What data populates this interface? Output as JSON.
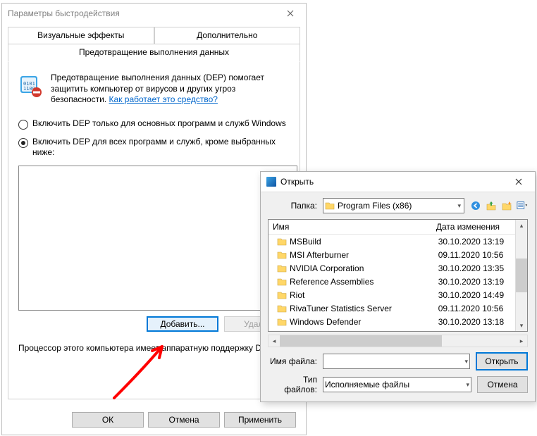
{
  "perf": {
    "title": "Параметры быстродействия",
    "tab_visual": "Визуальные эффекты",
    "tab_advanced": "Дополнительно",
    "tab_dep": "Предотвращение выполнения данных",
    "intro": "Предотвращение выполнения данных (DEP) помогает защитить компьютер от вирусов и других угроз безопасности. ",
    "intro_link": "Как работает это средство?",
    "radio1": "Включить DEP только для основных программ и служб Windows",
    "radio2": "Включить DEP для всех программ и служб, кроме выбранных ниже:",
    "btn_add": "Добавить...",
    "btn_remove": "Удалить",
    "cpu_note": "Процессор этого компьютера имеет аппаратную поддержку DEP.",
    "btn_ok": "ОК",
    "btn_cancel": "Отмена",
    "btn_apply": "Применить"
  },
  "open": {
    "title": "Открыть",
    "folder_label": "Папка:",
    "folder_value": "Program Files (x86)",
    "col_name": "Имя",
    "col_date": "Дата изменения",
    "rows": [
      {
        "name": "MSBuild",
        "date": "30.10.2020 13:19"
      },
      {
        "name": "MSI Afterburner",
        "date": "09.11.2020 10:56"
      },
      {
        "name": "NVIDIA Corporation",
        "date": "30.10.2020 13:35"
      },
      {
        "name": "Reference Assemblies",
        "date": "30.10.2020 13:19"
      },
      {
        "name": "Riot",
        "date": "30.10.2020 14:49"
      },
      {
        "name": "RivaTuner Statistics Server",
        "date": "09.11.2020 10:56"
      },
      {
        "name": "Windows Defender",
        "date": "30.10.2020 13:18"
      }
    ],
    "filename_label": "Имя файла:",
    "filename_value": "",
    "filetype_label": "Тип файлов:",
    "filetype_value": "Исполняемые файлы",
    "btn_open": "Открыть",
    "btn_cancel": "Отмена"
  }
}
